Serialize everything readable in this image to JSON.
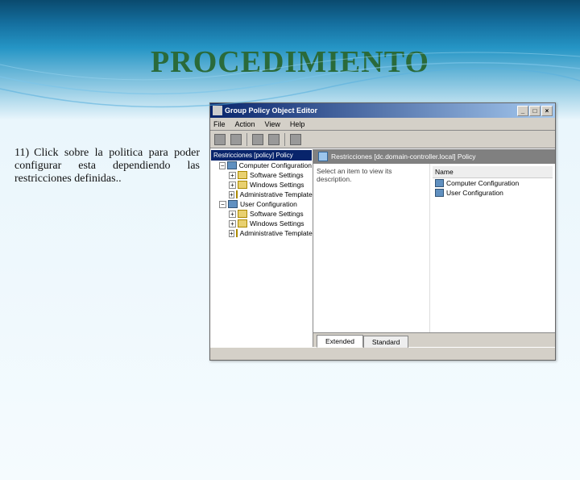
{
  "slide": {
    "title": "PROCEDIMIENTO",
    "step_number": "11)",
    "instruction": "Click sobre la politica para poder configurar esta dependiendo las restricciones definidas.."
  },
  "window": {
    "title": "Group Policy Object Editor",
    "buttons": {
      "min": "_",
      "max": "□",
      "close": "×"
    },
    "menu": {
      "file": "File",
      "action": "Action",
      "view": "View",
      "help": "Help"
    },
    "tree": {
      "root_label": "Restricciones [policy] Policy",
      "items": [
        {
          "label": "Computer Configuration",
          "type": "config",
          "expand": "−",
          "level": 1
        },
        {
          "label": "Software Settings",
          "type": "folder",
          "expand": "+",
          "level": 2
        },
        {
          "label": "Windows Settings",
          "type": "folder",
          "expand": "+",
          "level": 2
        },
        {
          "label": "Administrative Templates",
          "type": "folder",
          "expand": "+",
          "level": 2
        },
        {
          "label": "User Configuration",
          "type": "config",
          "expand": "−",
          "level": 1
        },
        {
          "label": "Software Settings",
          "type": "folder",
          "expand": "+",
          "level": 2
        },
        {
          "label": "Windows Settings",
          "type": "folder",
          "expand": "+",
          "level": 2
        },
        {
          "label": "Administrative Templates",
          "type": "folder",
          "expand": "+",
          "level": 2
        }
      ]
    },
    "right": {
      "header": "Restricciones [dc.domain-controller.local] Policy",
      "desc_hint": "Select an item to view its description.",
      "name_header": "Name",
      "items": [
        {
          "label": "Computer Configuration"
        },
        {
          "label": "User Configuration"
        }
      ]
    },
    "tabs": {
      "extended": "Extended",
      "standard": "Standard"
    }
  }
}
